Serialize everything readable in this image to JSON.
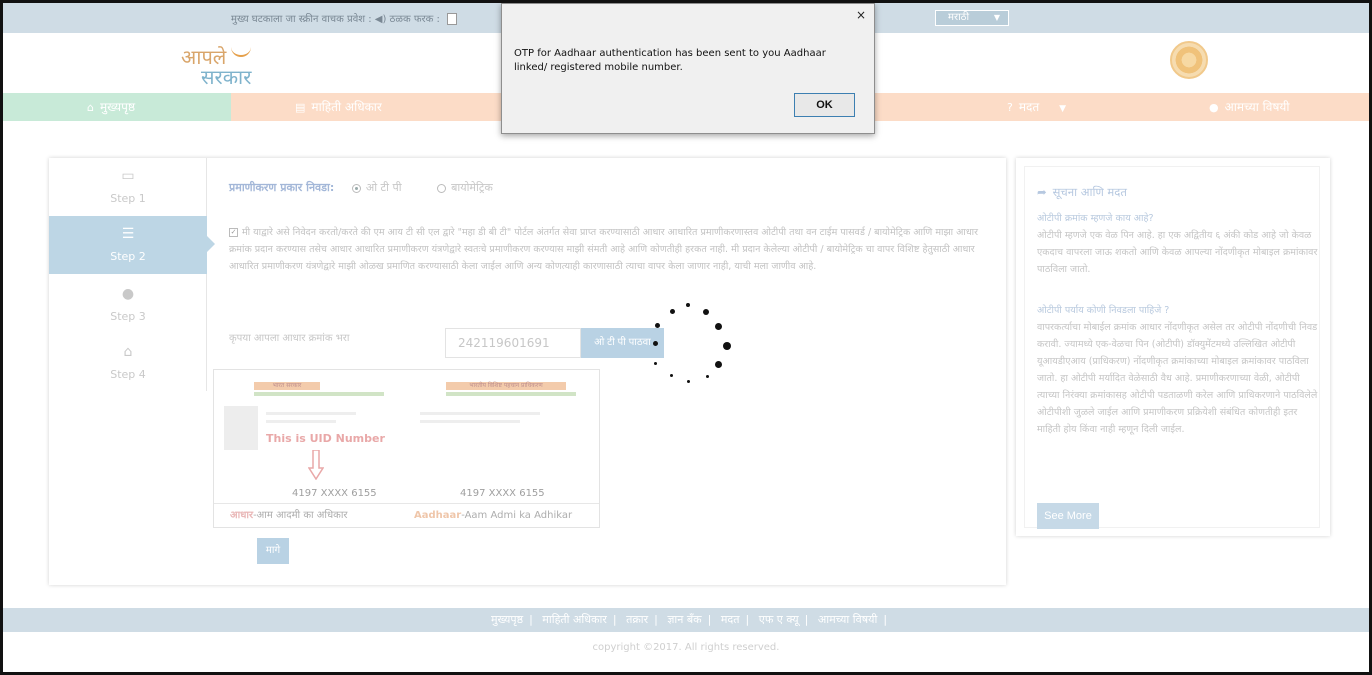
{
  "accessibility": {
    "text": "मुख्य घटकाला जा   स्क्रीन वाचक प्रवेश : ◀)   ठळक फरक :"
  },
  "language": {
    "selected": "मराठी"
  },
  "nav": {
    "home": "मुख्यपृष्ठ",
    "rti": "माहिती अधिकार",
    "help": "मदत",
    "about": "आमच्या विषयी"
  },
  "steps": [
    {
      "label": "Step 1"
    },
    {
      "label": "Step 2"
    },
    {
      "label": "Step 3"
    },
    {
      "label": "Step 4"
    }
  ],
  "form": {
    "auth_label": "प्रमाणीकरण प्रकार निवडा:",
    "option_otp": "ओ टी पी",
    "option_bio": "बायोमेट्रिक",
    "consent": "मी याद्वारे असे निवेदन करतो/करते की एम आय टी सी एल द्वारे \"महा डी बी टी\" पोर्टल अंतर्गत सेवा प्राप्त करण्यासाठी आधार आधारित प्रमाणीकरणास्तव ओटीपी तथा वन टाईम पासवर्ड / बायोमेट्रिक आणि माझा आधार क्रमांक प्रदान करण्यास तसेच आधार आधारित प्रमाणीकरण यंत्रणेद्वारे स्वतःचे प्रमाणीकरण करण्यास माझी संमती आहे आणि कोणतीही हरकत नाही. मी प्रदान केलेल्या ओटीपी / बायोमेट्रिक चा वापर विशिष्ट हेतुसाठी आधार आधारित प्रमाणीकरण यंत्रणेद्वारे माझी ओळख प्रमाणित करण्यासाठी केला जाईल आणि अन्य कोणत्याही कारणासाठी त्याचा वापर केला जाणार नाही, याची मला जाणीव आहे.",
    "aadhaar_label": "कृपया आपला आधार क्रमांक भरा",
    "aadhaar_value": "242119601691",
    "otp_button": "ओ टी पी पाठवा",
    "next_button": "मागे"
  },
  "uid_card": {
    "left_header": "भारत सरकार",
    "right_header": "भारतीय विशिष्ट पहचान प्राधिकरण",
    "mark": "This is UID Number",
    "num_left": "4197 XXXX 6155",
    "num_right": "4197 XXXX 6155",
    "band_left_bold": "आधार",
    "band_left": "-आम आदमी का अधिकार",
    "band_right_bold": "Aadhaar",
    "band_right": "-Aam Admi ka Adhikar"
  },
  "help": {
    "title": "सूचना आणि मदत",
    "q1": "ओटीपी क्रमांक म्हणजे काय आहे?",
    "a1": "ओटीपी म्हणजे एक वेळ पिन आहे. हा एक अद्वितीय ६ अंकी कोड आहे जो केवळ एकदाच वापरला जाऊ शकतो आणि केवळ आपल्या नोंदणीकृत मोबाइल क्रमांकावर पाठविला जातो.",
    "q2": "ओटीपी पर्याय कोणी निवडला पाहिजे ?",
    "a2": "वापरकर्त्याचा मोबाईल क्रमांक आधार नोंदणीकृत असेल तर ओटीपी नोंदणीची निवड करावी. ज्यामध्ये एक-वेळचा पिन (ओटीपी) डॉक्युमेंटमध्ये उल्लिखित ओटीपी यूआयडीएआय (प्राधिकरण) नोंदणीकृत क्रमांकाच्या मोबाइल क्रमांकावर पाठविला जातो. हा ओटीपी मर्यादित वेळेसाठी वैध आहे. प्रमाणीकरणाच्या वेळी, ओटीपी त्याच्या निरंक्या क्रमांकासह ओटीपी पडताळणी करेल आणि प्राधिकरणाने पाठविलेले ओटीपीशी जुळले जाईल आणि प्रमाणीकरण प्रक्रियेशी संबंधित कोणतीही इतर माहिती होय किंवा नाही म्हणून दिली जाईल.",
    "see_more": "See More"
  },
  "footer": {
    "links": [
      "मुख्यपृष्ठ",
      "माहिती अधिकार",
      "तक्रार",
      "ज्ञान बँक",
      "मदत",
      "एफ ए क्यू",
      "आमच्या विषयी"
    ],
    "copyright": "copyright ©2017. All rights reserved."
  },
  "dialog": {
    "message": "OTP for Aadhaar authentication has been sent to you Aadhaar linked/ registered mobile number.",
    "ok_label": "OK",
    "close_glyph": "×"
  }
}
